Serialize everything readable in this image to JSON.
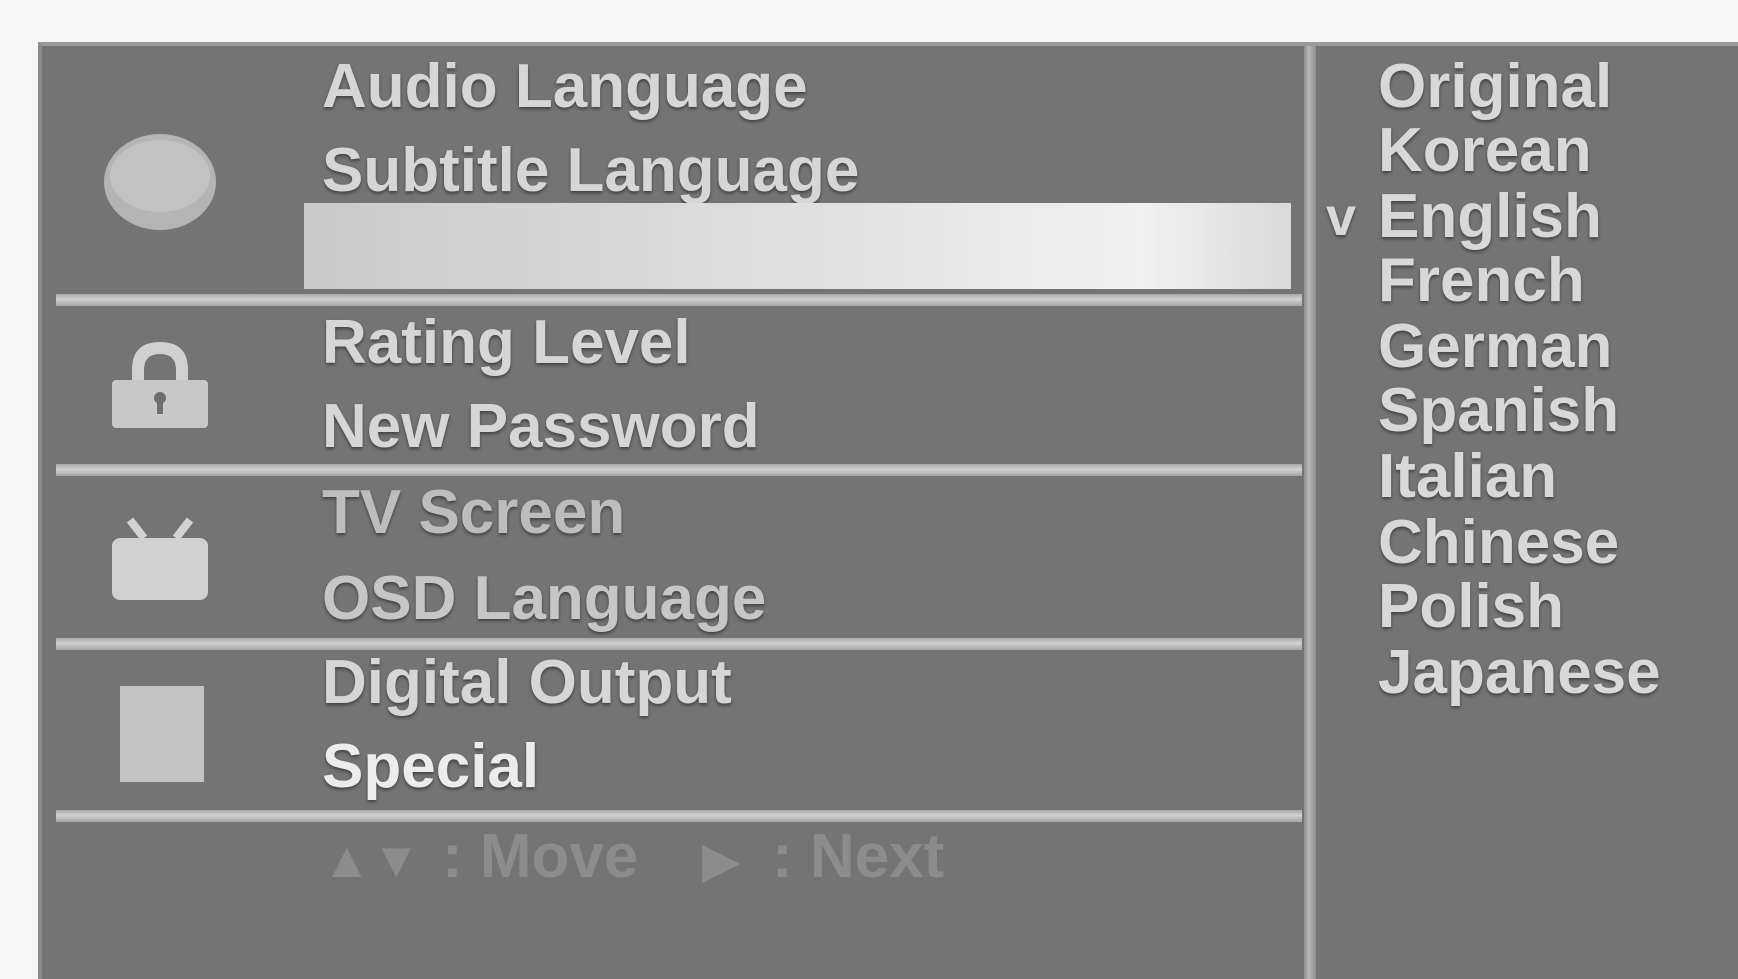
{
  "menu": {
    "groups": [
      {
        "icon": "disc-icon",
        "items": [
          "Audio Language",
          "Subtitle Language",
          ""
        ]
      },
      {
        "icon": "lock-icon",
        "items": [
          "Rating Level",
          "New Password"
        ]
      },
      {
        "icon": "tv-icon",
        "items": [
          "TV Screen",
          "OSD Language"
        ]
      },
      {
        "icon": "square-icon",
        "items": [
          "Digital Output",
          "Special"
        ]
      }
    ]
  },
  "footer": {
    "move_symbol": "▲▼",
    "move_label": ": Move",
    "next_symbol": "▶",
    "next_label": ": Next"
  },
  "options": {
    "check_mark": "v",
    "selected_index": 2,
    "items": [
      "Original",
      "Korean",
      "English",
      "French",
      "German",
      "Spanish",
      "Italian",
      "Chinese",
      "Polish",
      "Japanese"
    ]
  }
}
